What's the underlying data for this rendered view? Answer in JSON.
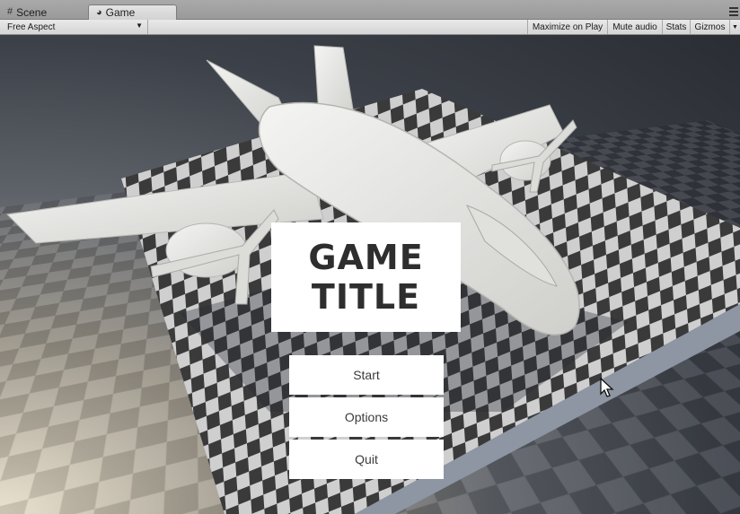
{
  "editor": {
    "tabs": [
      {
        "label": "Scene",
        "icon": "grid-icon"
      },
      {
        "label": "Game",
        "icon": "pacman-icon",
        "active": true
      }
    ]
  },
  "toolbar": {
    "aspect_label": "Free Aspect",
    "maximize_label": "Maximize on Play",
    "mute_label": "Mute audio",
    "stats_label": "Stats",
    "gizmos_label": "Gizmos"
  },
  "game": {
    "title_line1": "GAME",
    "title_line2": "TITLE",
    "buttons": {
      "start": "Start",
      "options": "Options",
      "quit": "Quit"
    }
  },
  "colors": {
    "panel": "#ffffff",
    "title_text": "#2e2e2e",
    "button_text": "#3b3b3b",
    "active_tab": "#d8d8d8"
  }
}
